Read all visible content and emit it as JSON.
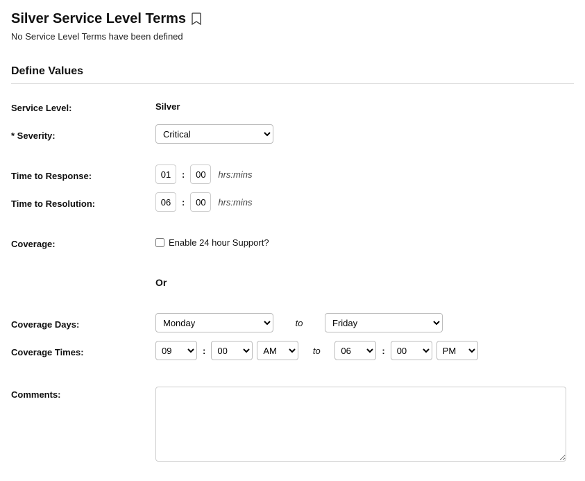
{
  "header": {
    "title": "Silver Service Level Terms",
    "subtitle": "No Service Level Terms have been defined"
  },
  "section": {
    "title": "Define Values"
  },
  "labels": {
    "service_level": "Service Level:",
    "severity": "* Severity:",
    "time_to_response": "Time to Response:",
    "time_to_resolution": "Time to Resolution:",
    "coverage": "Coverage:",
    "coverage_days": "Coverage Days:",
    "coverage_times": "Coverage Times:",
    "comments": "Comments:"
  },
  "values": {
    "service_level": "Silver",
    "severity": "Critical",
    "response_hrs": "01",
    "response_mins": "00",
    "resolution_hrs": "06",
    "resolution_mins": "00",
    "hrs_mins_hint": "hrs:mins",
    "enable_24_label": "Enable 24 hour Support?",
    "or_text": "Or",
    "to_text": "to",
    "day_from": "Monday",
    "day_to": "Friday",
    "time_from_hr": "09",
    "time_from_min": "00",
    "time_from_ampm": "AM",
    "time_to_hr": "06",
    "time_to_min": "00",
    "time_to_ampm": "PM",
    "comments": ""
  }
}
